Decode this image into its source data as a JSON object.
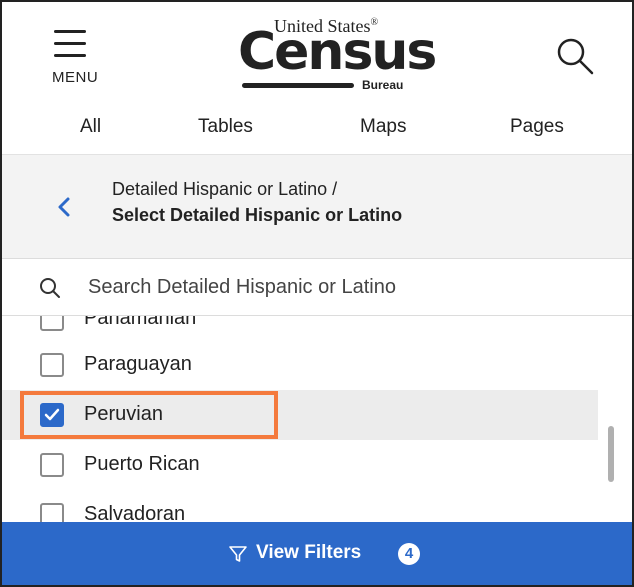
{
  "header": {
    "menu_label": "MENU",
    "logo_top": "United States",
    "logo_reg": "®",
    "logo_main": "Census",
    "logo_bottom": "Bureau"
  },
  "tabs": [
    {
      "label": "All"
    },
    {
      "label": "Tables"
    },
    {
      "label": "Maps"
    },
    {
      "label": "Pages"
    }
  ],
  "breadcrumb": {
    "parent": "Detailed Hispanic or Latino /",
    "current": "Select Detailed Hispanic or Latino"
  },
  "search": {
    "placeholder": "Search Detailed Hispanic or Latino",
    "value": ""
  },
  "list": {
    "items": [
      {
        "label": "Panamanian",
        "checked": false
      },
      {
        "label": "Paraguayan",
        "checked": false
      },
      {
        "label": "Peruvian",
        "checked": true
      },
      {
        "label": "Puerto Rican",
        "checked": false
      },
      {
        "label": "Salvadoran",
        "checked": false
      }
    ]
  },
  "footer": {
    "button_label": "View Filters",
    "filter_count": "4"
  },
  "colors": {
    "accent": "#2c69c9",
    "highlight": "#f47a3d"
  }
}
